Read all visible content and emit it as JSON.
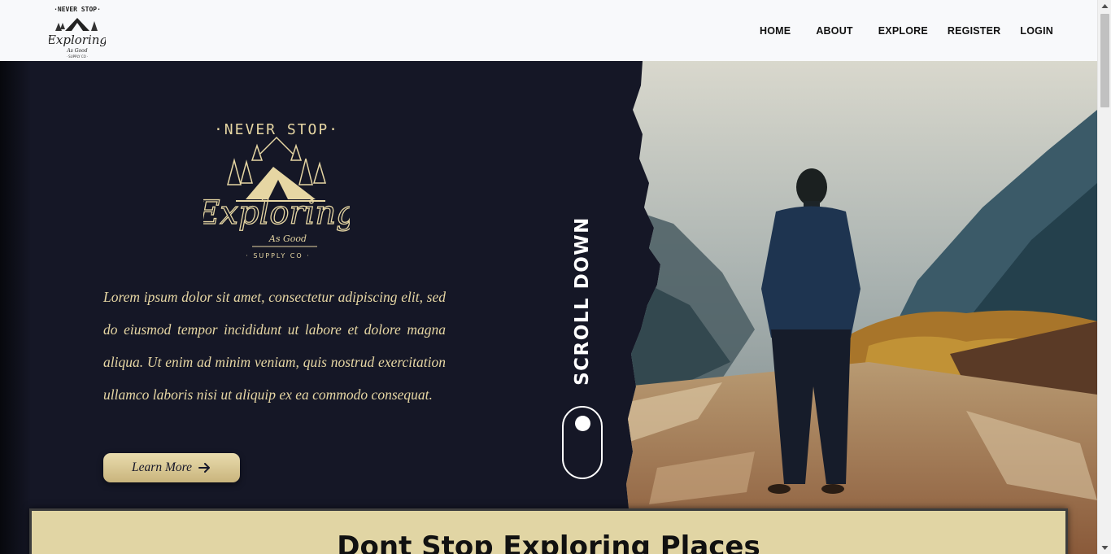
{
  "nav": {
    "logo_alt": "Never Stop Exploring As Good Supply Co.",
    "links": [
      "HOME",
      "ABOUT",
      "EXPLORE",
      "REGISTER",
      "LOGIN"
    ]
  },
  "hero": {
    "logo_text": {
      "top": "·NEVER STOP·",
      "main": "Exploring",
      "sub": "As Good",
      "bottom": "· SUPPLY CO ·"
    },
    "paragraph": "Lorem ipsum dolor sit amet, consectetur adipiscing elit, sed do eiusmod tempor incididunt ut labore et dolore magna aliqua. Ut enim ad minim veniam, quis nostrud exercitation ullamco laboris nisi ut aliquip ex ea commodo consequat.",
    "button_label": "Learn More",
    "scroll_label": "SCROLL DOWN"
  },
  "section": {
    "title": "Dont Stop Exploring Places"
  },
  "colors": {
    "hero_bg": "#151726",
    "accent": "#e6d6a3",
    "card_bg": "#e1d5a4"
  }
}
